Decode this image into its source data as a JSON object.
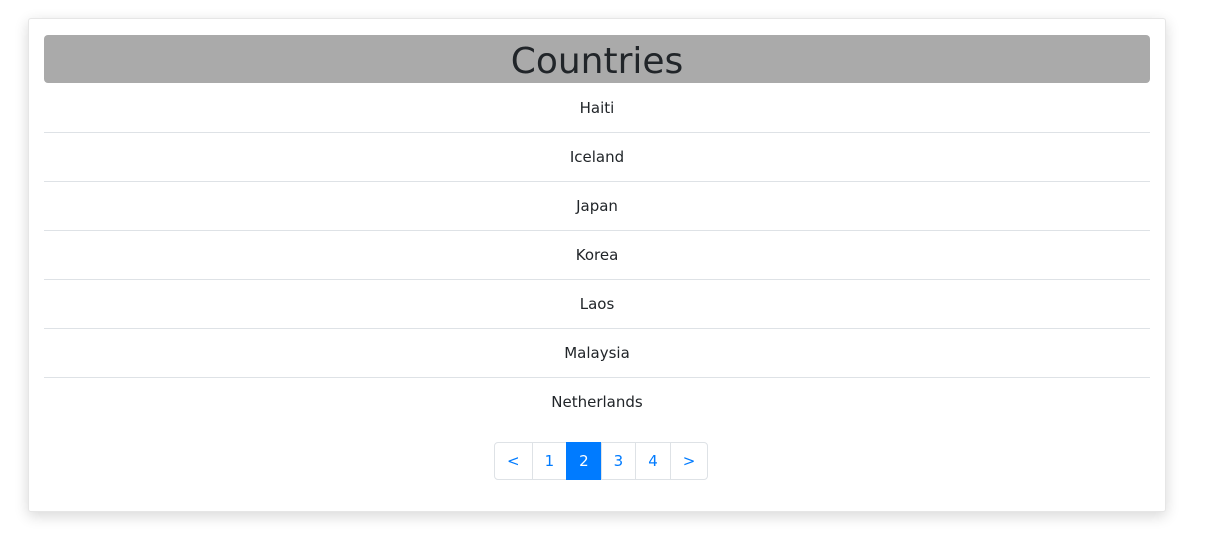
{
  "title": "Countries",
  "countries": [
    "Haiti",
    "Iceland",
    "Japan",
    "Korea",
    "Laos",
    "Malaysia",
    "Netherlands"
  ],
  "pagination": {
    "prev_label": "<",
    "next_label": ">",
    "pages": [
      "1",
      "2",
      "3",
      "4"
    ],
    "current_page": "2",
    "active_color": "#007bff"
  }
}
